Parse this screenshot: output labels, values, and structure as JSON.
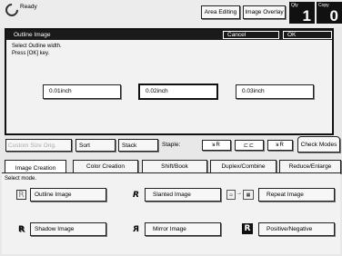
{
  "status": {
    "text": "Ready",
    "icon": "ready-icon"
  },
  "topbar": {
    "area_editing": "Area Editing",
    "image_overlay": "Image Overlay",
    "qty_label": "Qty",
    "qty_value": "1",
    "copy_label": "Copy",
    "copy_value": "0"
  },
  "dialog": {
    "title": "Outline Image",
    "cancel": "Cancel",
    "ok": "OK",
    "message_line1": "Select Outline width.",
    "message_line2": "Press [OK] key.",
    "options": [
      "0.01inch",
      "0.02inch",
      "0.03inch"
    ],
    "selected": "0.02inch"
  },
  "toolbar": {
    "custom_size_orig": "Custom Size Orig.",
    "sort": "Sort",
    "stack": "Stack",
    "staple_label": "Staple:",
    "staple_opts": [
      "ᴚR",
      "⊏⊏",
      "ᴚR"
    ],
    "check_modes": "Check Modes"
  },
  "tabs": [
    "Image Creation",
    "Color Creation",
    "Shift/Book",
    "Duplex/Combine",
    "Reduce/Enlarge"
  ],
  "active_tab": "Image Creation",
  "panel": {
    "select_mode": "Select mode.",
    "modes": [
      {
        "label": "Outline Image",
        "icon": "outline-R-icon"
      },
      {
        "label": "Slanted Image",
        "icon": "slanted-R-icon"
      },
      {
        "label": "Repeat Image",
        "icon": "repeat-image-icon"
      },
      {
        "label": "Shadow Image",
        "icon": "shadow-R-icon"
      },
      {
        "label": "Mirror Image",
        "icon": "mirror-R-icon"
      },
      {
        "label": "Positive/Negative",
        "icon": "negative-R-icon"
      }
    ]
  }
}
